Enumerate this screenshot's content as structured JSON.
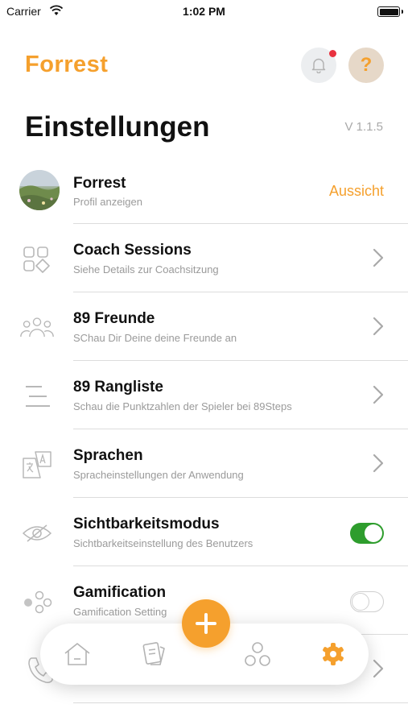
{
  "status_bar": {
    "carrier": "Carrier",
    "time": "1:02 PM"
  },
  "header": {
    "app_title": "Forrest",
    "help_label": "?"
  },
  "page": {
    "title": "Einstellungen",
    "version": "V 1.1.5"
  },
  "profile": {
    "name": "Forrest",
    "subtitle": "Profil anzeigen",
    "action_label": "Aussicht"
  },
  "settings": [
    {
      "title": "Coach Sessions",
      "subtitle": "Siehe Details zur Coachsitzung",
      "icon": "grid-shapes-icon",
      "control": "chevron"
    },
    {
      "title": "89 Freunde",
      "subtitle": "SChau Dir Deine deine Freunde an",
      "icon": "friends-icon",
      "control": "chevron"
    },
    {
      "title": "89 Rangliste",
      "subtitle": "Schau die Punktzahlen der Spieler bei 89Steps",
      "icon": "leaderboard-icon",
      "control": "chevron"
    },
    {
      "title": "Sprachen",
      "subtitle": "Spracheinstellungen der Anwendung",
      "icon": "translate-icon",
      "control": "chevron"
    },
    {
      "title": "Sichtbarkeitsmodus",
      "subtitle": "Sichtbarkeitseinstellung des Benutzers",
      "icon": "eye-off-icon",
      "control": "toggle",
      "enabled": true
    },
    {
      "title": "Gamification",
      "subtitle": "Gamification Setting",
      "icon": "gamepad-icon",
      "control": "toggle",
      "enabled": false
    }
  ],
  "partial_row": {
    "icon": "phone-icon",
    "control": "chevron"
  },
  "tabbar": {
    "tabs": [
      "home-icon",
      "cards-icon",
      "add-icon",
      "community-icon",
      "settings-gear-icon"
    ],
    "active": "settings-gear-icon"
  },
  "colors": {
    "accent": "#f5a02d",
    "toggle_on": "#2e9d2d",
    "notification_dot": "#e8323f",
    "muted_text": "#9a9a9a"
  }
}
